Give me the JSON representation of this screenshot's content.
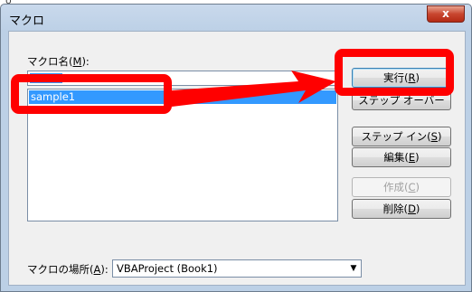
{
  "marker": "o",
  "window": {
    "title": "マクロ",
    "close_glyph": "x"
  },
  "macro_name": {
    "label_prefix": "マクロ名(",
    "label_key": "M",
    "label_suffix": "):",
    "value": ""
  },
  "macro_list": {
    "items": [
      "sample1"
    ],
    "selected": "sample1"
  },
  "buttons": {
    "run": {
      "prefix": "実行(",
      "key": "R",
      "suffix": ")"
    },
    "step_over": {
      "text": "ステップ オーバー"
    },
    "step_into": {
      "prefix": "ステップ イン(",
      "key": "S",
      "suffix": ")"
    },
    "edit": {
      "prefix": "編集(",
      "key": "E",
      "suffix": ")"
    },
    "create": {
      "prefix": "作成(",
      "key": "C",
      "suffix": ")"
    },
    "delete": {
      "prefix": "削除(",
      "key": "D",
      "suffix": ")"
    }
  },
  "location": {
    "label_prefix": "マクロの場所(",
    "label_key": "A",
    "label_suffix": "):",
    "value": "VBAProject (Book1)"
  },
  "annotation_color": "#ff0000",
  "icons": {
    "close": "close-icon",
    "dropdown": "chevron-down-icon",
    "arrow": "red-arrow"
  }
}
